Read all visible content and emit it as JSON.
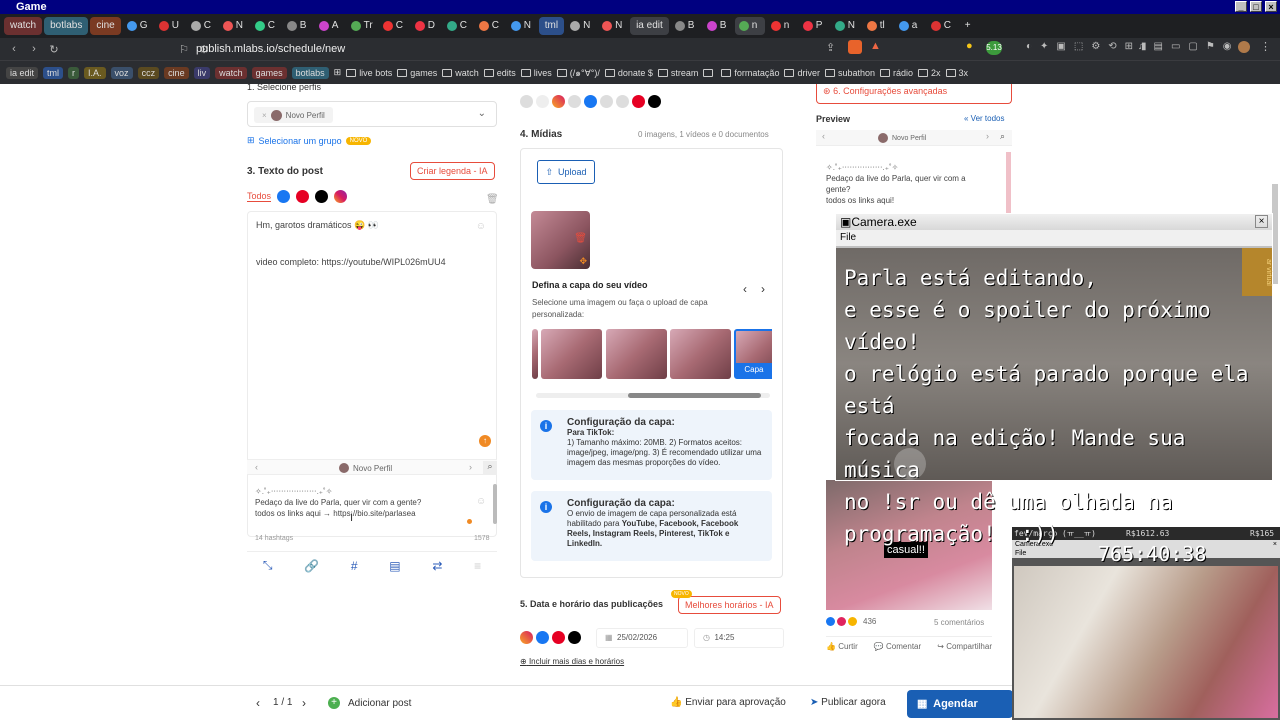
{
  "window": {
    "title": "Game"
  },
  "tabs": [
    {
      "label": "watch",
      "color": "#6b3030"
    },
    {
      "label": "botlabs",
      "color": "#2f5f73"
    },
    {
      "label": "cine",
      "color": "#7a3a22"
    },
    {
      "label": "G"
    },
    {
      "label": "U"
    },
    {
      "label": "C"
    },
    {
      "label": "N"
    },
    {
      "label": "C"
    },
    {
      "label": "B"
    },
    {
      "label": "A"
    },
    {
      "label": "Tr"
    },
    {
      "label": "C"
    },
    {
      "label": "D"
    },
    {
      "label": "C"
    },
    {
      "label": "C"
    },
    {
      "label": "N"
    },
    {
      "label": "tml",
      "color": "#2c4f8a"
    },
    {
      "label": "N"
    },
    {
      "label": "N"
    },
    {
      "label": "ia edit",
      "color": "#3d3f44"
    },
    {
      "label": "B"
    },
    {
      "label": "B"
    },
    {
      "label": "n",
      "active": true
    },
    {
      "label": "n"
    },
    {
      "label": "P"
    },
    {
      "label": "N"
    },
    {
      "label": "tl"
    },
    {
      "label": "a"
    },
    {
      "label": "C"
    }
  ],
  "address": {
    "url": "publish.mlabs.io/schedule/new"
  },
  "bookmarks": {
    "chips": [
      "ia edit",
      "tml",
      "r",
      "I.A.",
      "voz",
      "ccz",
      "cine",
      "liv",
      "watch",
      "games",
      "botlabs"
    ],
    "chip_colors": [
      "#444",
      "#2c4f8a",
      "#3a5a3a",
      "#6a5a20",
      "#3a4f6a",
      "#5a4a20",
      "#6a3a22",
      "#3a3a6a",
      "#6b3030",
      "#6b3030",
      "#2f5f73"
    ],
    "items": [
      "live bots",
      "games",
      "watch",
      "edits",
      "lives",
      "(/๑°∀°)/",
      "donate $",
      "stream",
      "",
      "formatação",
      "driver",
      "subathon",
      "rádio",
      "2x",
      "3x"
    ]
  },
  "left": {
    "section_profile": "1. Selecione perfis",
    "profile_chip": "Novo Perfil",
    "group_link": "Selecionar um grupo",
    "group_badge": "NOVO",
    "section_text": "3. Texto do post",
    "create_caption": "Criar legenda - IA",
    "all_label": "Todos",
    "post_line1": "Hm, garotos dramáticos 😜 👀",
    "post_line2": "video completo:  https://youtube/WIPL026mUU4",
    "preview_profile": "Novo Perfil",
    "preview_line1": "✧.˚₊‧‧‧‧‧‧‧‧‧‧‧‧‧‧‧‧‧‧.₊˚✧",
    "preview_line2": "Pedaço da live do Parla, quer vir com a gente?",
    "preview_line3": "todos os links aqui → https://bio.site/parlasea",
    "hashtags": "14 hashtags",
    "char_count": "1578"
  },
  "media": {
    "section": "4. Mídias",
    "counts": "0 imagens, 1 vídeos e 0 documentos",
    "upload": "Upload",
    "cover_title": "Defina a capa do seu vídeo",
    "cover_desc": "Selecione uma imagem ou faça o upload de capa personalizada:",
    "capa_label": "Capa",
    "info1_title": "Configuração da capa:",
    "info1_sub": "Para TikTok:",
    "info1_body": "1) Tamanho máximo: 20MB. 2) Formatos aceitos: image/jpeg, image/png. 3) É recomendado utilizar uma imagem das mesmas proporções do vídeo.",
    "info2_title": "Configuração da capa:",
    "info2_body1": "O envio de imagem de capa personalizada está habilitado para ",
    "info2_platforms": "YouTube, Facebook, Facebook Reels, Instagram Reels, Pinterest, TikTok e LinkedIn.",
    "section_date": "5. Data e horário das publicações",
    "best_times": "Melhores horários - IA",
    "best_badge": "NOVO",
    "date": "25/02/2026",
    "time": "14:25",
    "more_days": "Incluir mais dias e horários"
  },
  "preview": {
    "advanced": "6. Configurações avançadas",
    "title": "Preview",
    "see_all": "Ver todos",
    "profile": "Novo Perfil",
    "line1": "✧.˚₊‧‧‧‧‧‧‧‧‧‧‧‧‧‧‧‧.₊˚✧",
    "line2": "Pedaço da live do Parla, quer vir com a gente?",
    "line3": "todos os links aqui!",
    "casual": "casual!!",
    "reactions": "436",
    "comments": "5 comentários",
    "like": "Curtir",
    "comment": "Comentar",
    "share": "Compartilhar"
  },
  "camera": {
    "title": "Camera.exe",
    "menu": "File",
    "text": "Parla está editando,\ne esse é o spoiler do próximo vídeo!\no relógio está parado porque ela está\nfocada na edição! Mande sua música\nno !sr ou dê uma olhada na\nprogramação!  :))",
    "side_label": "ar virtual"
  },
  "stream": {
    "month": "fev/março",
    "face": "(ㅠ__ㅠ)",
    "goal1": "R$1612.63",
    "goal2": "R$165",
    "webcam_title": "Camera.exe",
    "webcam_menu": "File",
    "timer": "765:40:38"
  },
  "footer": {
    "page": "1 / 1",
    "add_post": "Adicionar post",
    "approve": "Enviar para aprovação",
    "publish": "Publicar agora",
    "schedule": "Agendar"
  }
}
